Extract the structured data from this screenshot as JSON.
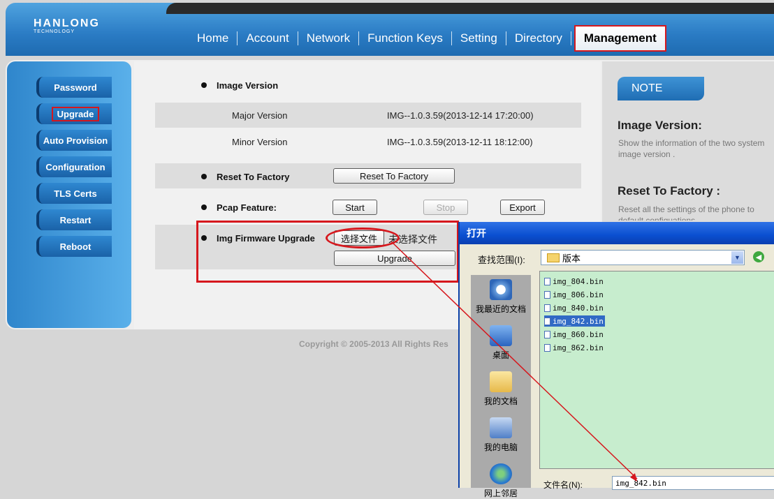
{
  "brand": {
    "name": "HANLONG",
    "tagline": "TECHNOLOGY"
  },
  "nav": {
    "items": [
      "Home",
      "Account",
      "Network",
      "Function Keys",
      "Setting",
      "Directory"
    ],
    "active": "Management"
  },
  "sidebar": {
    "items": [
      "Password",
      "Upgrade",
      "Auto Provision",
      "Configuration",
      "TLS Certs",
      "Restart",
      "Reboot"
    ],
    "active": "Upgrade"
  },
  "main": {
    "image_version": {
      "label": "Image Version",
      "major_label": "Major Version",
      "major_value": "IMG--1.0.3.59(2013-12-14 17:20:00)",
      "minor_label": "Minor Version",
      "minor_value": "IMG--1.0.3.59(2013-12-11 18:12:00)"
    },
    "reset": {
      "label": "Reset To Factory",
      "button": "Reset To Factory"
    },
    "pcap": {
      "label": "Pcap Feature:",
      "start": "Start",
      "stop": "Stop",
      "export": "Export"
    },
    "img_upgrade": {
      "label": "Img Firmware Upgrade",
      "choose_button": "选择文件",
      "no_file": "未选择文件",
      "upgrade_button": "Upgrade"
    }
  },
  "note": {
    "badge": "NOTE",
    "sections": [
      {
        "title": "Image Version:",
        "text": "Show the information of the two system image version ."
      },
      {
        "title": "Reset To Factory :",
        "text": "Reset all the settings of the phone to default configuations."
      }
    ]
  },
  "copyright": "Copyright © 2005-2013 All Rights Res",
  "dialog": {
    "title": "打开",
    "look_in_label": "查找范围(I):",
    "look_in_value": "版本",
    "places": [
      "我最近的文档",
      "桌面",
      "我的文档",
      "我的电脑",
      "网上邻居"
    ],
    "files": [
      "img_804.bin",
      "img_806.bin",
      "img_840.bin",
      "img_842.bin",
      "img_860.bin",
      "img_862.bin"
    ],
    "selected_file": "img_842.bin",
    "filename_label": "文件名(N):",
    "filename_value": "img_842.bin"
  },
  "colors": {
    "annotation_red": "#d6171d",
    "header_blue": "#2a7bc4",
    "file_list_bg": "#c7edce"
  }
}
